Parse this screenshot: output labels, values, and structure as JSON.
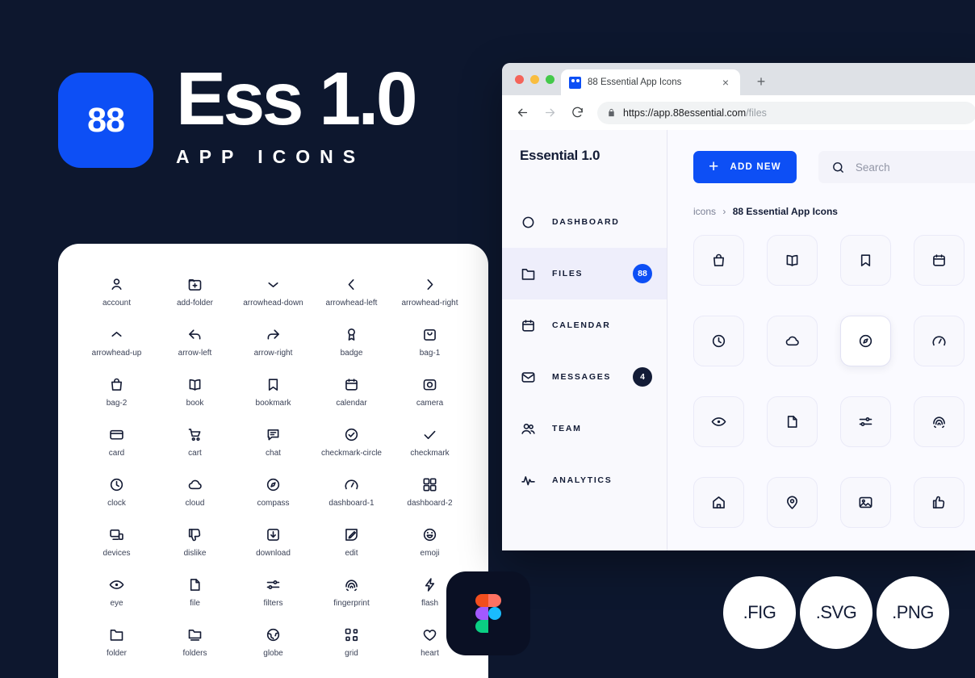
{
  "hero": {
    "badge_number": "88",
    "title": "Ess 1.0",
    "subtitle": "APP ICONS",
    "accent_color": "#0d4ff5",
    "background_color": "#0d172e"
  },
  "icon_sheet": {
    "icons": [
      {
        "name": "account",
        "glyph": "account-icon"
      },
      {
        "name": "add-folder",
        "glyph": "add-folder-icon"
      },
      {
        "name": "arrowhead-down",
        "glyph": "arrowhead-down-icon"
      },
      {
        "name": "arrowhead-left",
        "glyph": "arrowhead-left-icon"
      },
      {
        "name": "arrowhead-right",
        "glyph": "arrowhead-right-icon"
      },
      {
        "name": "arrowhead-up",
        "glyph": "arrowhead-up-icon"
      },
      {
        "name": "arrow-left",
        "glyph": "arrow-left-icon"
      },
      {
        "name": "arrow-right",
        "glyph": "arrow-right-icon"
      },
      {
        "name": "badge",
        "glyph": "badge-icon"
      },
      {
        "name": "bag-1",
        "glyph": "bag-1-icon"
      },
      {
        "name": "bag-2",
        "glyph": "bag-2-icon"
      },
      {
        "name": "book",
        "glyph": "book-icon"
      },
      {
        "name": "bookmark",
        "glyph": "bookmark-icon"
      },
      {
        "name": "calendar",
        "glyph": "calendar-icon"
      },
      {
        "name": "camera",
        "glyph": "camera-icon"
      },
      {
        "name": "card",
        "glyph": "card-icon"
      },
      {
        "name": "cart",
        "glyph": "cart-icon"
      },
      {
        "name": "chat",
        "glyph": "chat-icon"
      },
      {
        "name": "checkmark-circle",
        "glyph": "checkmark-circle-icon"
      },
      {
        "name": "checkmark",
        "glyph": "checkmark-icon"
      },
      {
        "name": "clock",
        "glyph": "clock-icon"
      },
      {
        "name": "cloud",
        "glyph": "cloud-icon"
      },
      {
        "name": "compass",
        "glyph": "compass-icon"
      },
      {
        "name": "dashboard-1",
        "glyph": "dashboard-1-icon"
      },
      {
        "name": "dashboard-2",
        "glyph": "dashboard-2-icon"
      },
      {
        "name": "devices",
        "glyph": "devices-icon"
      },
      {
        "name": "dislike",
        "glyph": "dislike-icon"
      },
      {
        "name": "download",
        "glyph": "download-icon"
      },
      {
        "name": "edit",
        "glyph": "edit-icon"
      },
      {
        "name": "emoji",
        "glyph": "emoji-icon"
      },
      {
        "name": "eye",
        "glyph": "eye-icon"
      },
      {
        "name": "file",
        "glyph": "file-icon"
      },
      {
        "name": "filters",
        "glyph": "filters-icon"
      },
      {
        "name": "fingerprint",
        "glyph": "fingerprint-icon"
      },
      {
        "name": "flash",
        "glyph": "flash-icon"
      },
      {
        "name": "folder",
        "glyph": "folder-icon"
      },
      {
        "name": "folders",
        "glyph": "folders-icon"
      },
      {
        "name": "globe",
        "glyph": "globe-icon"
      },
      {
        "name": "grid",
        "glyph": "grid-icon"
      },
      {
        "name": "heart",
        "glyph": "heart-icon"
      }
    ]
  },
  "browser": {
    "tab": {
      "title": "88 Essential App Icons",
      "close_label": "×",
      "new_tab_label": "+"
    },
    "toolbar": {
      "back_label": "←",
      "forward_label": "→",
      "reload_label": "↻",
      "url_host": "https://app.88essential.com",
      "url_path": "/files"
    }
  },
  "app": {
    "sidebar": {
      "title": "Essential 1.0",
      "items": [
        {
          "label": "DASHBOARD",
          "icon": "dashboard-icon",
          "badge": null,
          "badge_style": null,
          "active": false
        },
        {
          "label": "FILES",
          "icon": "folder-icon",
          "badge": "88",
          "badge_style": "blue",
          "active": true
        },
        {
          "label": "CALENDAR",
          "icon": "calendar-icon",
          "badge": null,
          "badge_style": null,
          "active": false
        },
        {
          "label": "MESSAGES",
          "icon": "mail-icon",
          "badge": "4",
          "badge_style": "dark",
          "active": false
        },
        {
          "label": "TEAM",
          "icon": "team-icon",
          "badge": null,
          "badge_style": null,
          "active": false
        },
        {
          "label": "ANALYTICS",
          "icon": "analytics-icon",
          "badge": null,
          "badge_style": null,
          "active": false
        }
      ]
    },
    "main": {
      "add_new_label": "ADD NEW",
      "add_new_plus": "+",
      "search_placeholder": "Search",
      "search_value": "",
      "breadcrumb_root": "icons",
      "breadcrumb_sep": "›",
      "breadcrumb_current": "88 Essential App Icons",
      "tiles": [
        {
          "name": "bag-2",
          "selected": false
        },
        {
          "name": "book",
          "selected": false
        },
        {
          "name": "bookmark",
          "selected": false
        },
        {
          "name": "calendar",
          "selected": false
        },
        {
          "name": "clock",
          "selected": false
        },
        {
          "name": "cloud",
          "selected": false
        },
        {
          "name": "compass",
          "selected": true
        },
        {
          "name": "dashboard-1",
          "selected": false
        },
        {
          "name": "eye",
          "selected": false
        },
        {
          "name": "file",
          "selected": false
        },
        {
          "name": "filters",
          "selected": false
        },
        {
          "name": "fingerprint",
          "selected": false
        },
        {
          "name": "home",
          "selected": false
        },
        {
          "name": "location",
          "selected": false
        },
        {
          "name": "image",
          "selected": false
        },
        {
          "name": "like",
          "selected": false
        }
      ]
    }
  },
  "figma_badge": {
    "label": "figma-logo",
    "colors": [
      "#f24e1e",
      "#ff7262",
      "#a259ff",
      "#1abcfe",
      "#0acf83"
    ]
  },
  "formats": [
    {
      "label": ".FIG"
    },
    {
      "label": ".SVG"
    },
    {
      "label": ".PNG"
    }
  ]
}
